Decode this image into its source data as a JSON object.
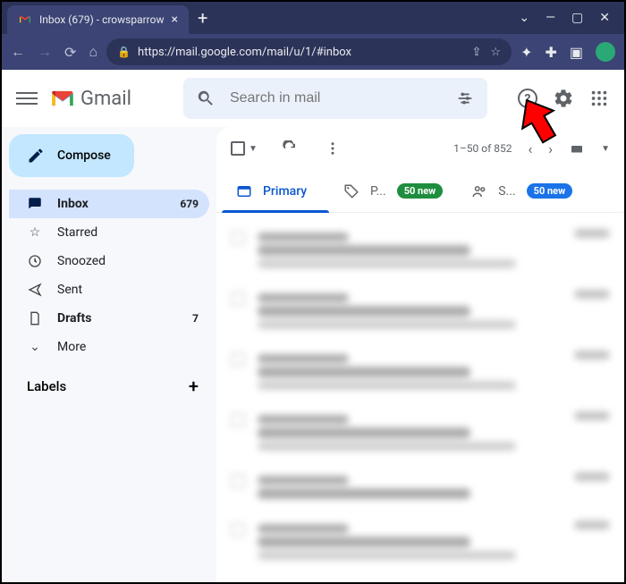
{
  "browser": {
    "tab_title": "Inbox (679) - crowsparrow",
    "url": "https://mail.google.com/mail/u/1/#inbox"
  },
  "header": {
    "app_name": "Gmail",
    "search_placeholder": "Search in mail"
  },
  "sidebar": {
    "compose": "Compose",
    "items": [
      {
        "label": "Inbox",
        "count": "679"
      },
      {
        "label": "Starred",
        "count": ""
      },
      {
        "label": "Snoozed",
        "count": ""
      },
      {
        "label": "Sent",
        "count": ""
      },
      {
        "label": "Drafts",
        "count": "7"
      },
      {
        "label": "More",
        "count": ""
      }
    ],
    "labels_header": "Labels"
  },
  "toolbar": {
    "page_range": "1–50 of 852"
  },
  "tabs": {
    "primary": "Primary",
    "promotions_short": "P...",
    "promotions_badge": "50 new",
    "social_short": "S...",
    "social_badge": "50 new"
  }
}
